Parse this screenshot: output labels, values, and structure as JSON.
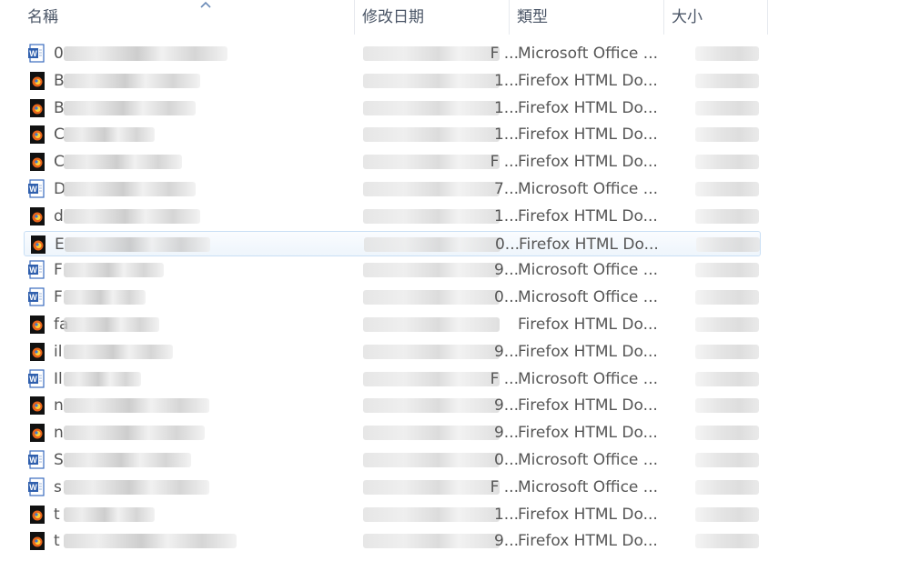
{
  "columns": {
    "name": "名稱",
    "modified": "修改日期",
    "type": "類型",
    "size": "大小"
  },
  "files": [
    {
      "name_initial": "0",
      "date_suffix": "F ...",
      "type": "Microsoft Office ...",
      "icon": "word-document-icon"
    },
    {
      "name_initial": "B",
      "date_suffix": "1...",
      "type": "Firefox HTML Do...",
      "icon": "firefox-html-icon"
    },
    {
      "name_initial": "B",
      "date_suffix": "1...",
      "type": "Firefox HTML Do...",
      "icon": "firefox-html-icon"
    },
    {
      "name_initial": "C",
      "date_suffix": "1...",
      "type": "Firefox HTML Do...",
      "icon": "firefox-html-icon"
    },
    {
      "name_initial": "C",
      "date_suffix": "F ...",
      "type": "Firefox HTML Do...",
      "icon": "firefox-html-icon"
    },
    {
      "name_initial": "D",
      "date_suffix": "7...",
      "type": "Microsoft Office ...",
      "icon": "word-document-icon"
    },
    {
      "name_initial": "d",
      "date_suffix": "1...",
      "type": "Firefox HTML Do...",
      "icon": "firefox-html-icon"
    },
    {
      "name_initial": "E",
      "date_suffix": "0...",
      "type": "Firefox HTML Do...",
      "icon": "firefox-html-icon",
      "selected": true
    },
    {
      "name_initial": "F",
      "date_suffix": "9...",
      "type": "Microsoft Office ...",
      "icon": "word-document-icon"
    },
    {
      "name_initial": "F",
      "date_suffix": "0...",
      "type": "Microsoft Office ...",
      "icon": "word-document-icon"
    },
    {
      "name_initial": "fa",
      "date_suffix": "",
      "type": "Firefox HTML Do...",
      "icon": "firefox-html-icon"
    },
    {
      "name_initial": "il",
      "date_suffix": "9...",
      "type": "Firefox HTML Do...",
      "icon": "firefox-html-icon"
    },
    {
      "name_initial": "Il",
      "date_suffix": "F ...",
      "type": "Microsoft Office ...",
      "icon": "word-document-icon"
    },
    {
      "name_initial": "n",
      "date_suffix": "9...",
      "type": "Firefox HTML Do...",
      "icon": "firefox-html-icon"
    },
    {
      "name_initial": "n",
      "date_suffix": "9...",
      "type": "Firefox HTML Do...",
      "icon": "firefox-html-icon"
    },
    {
      "name_initial": "S",
      "date_suffix": "0...",
      "type": "Microsoft Office ...",
      "icon": "word-document-icon"
    },
    {
      "name_initial": "s",
      "date_suffix": "F ...",
      "type": "Microsoft Office ...",
      "icon": "word-document-icon"
    },
    {
      "name_initial": "t",
      "date_suffix": "1...",
      "type": "Firefox HTML Do...",
      "icon": "firefox-html-icon"
    },
    {
      "name_initial": "t",
      "date_suffix": "9...",
      "type": "Firefox HTML Do...",
      "icon": "firefox-html-icon"
    }
  ],
  "colors": {
    "selection_border": "#c9dff5",
    "header_text": "#4a5566",
    "word_blue": "#2f5fad",
    "firefox_orange": "#e8651b"
  }
}
